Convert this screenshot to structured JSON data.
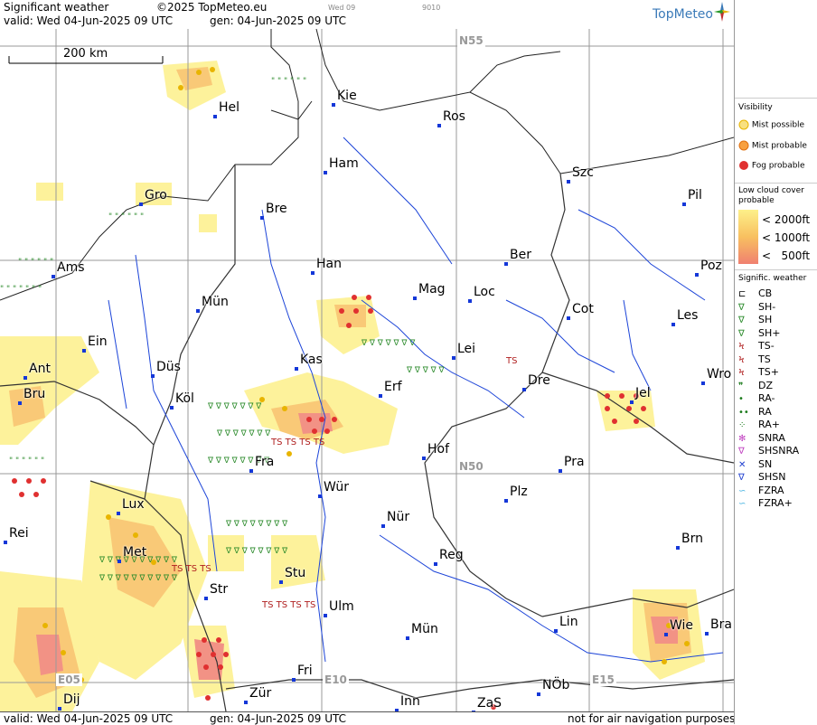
{
  "header": {
    "title": "Significant weather",
    "copyright": "©2025 TopMeteo.eu",
    "valid": "valid:  Wed  04-Jun-2025  09 UTC",
    "gen": "gen: 04-Jun-2025 09 UTC",
    "mini_day": "Wed 09",
    "mini_code": "9010",
    "logo": "TopMeteo"
  },
  "footer": {
    "valid": "valid:  Wed  04-Jun-2025  09 UTC",
    "gen": "gen: 04-Jun-2025 09 UTC",
    "note": "not for air navigation purposes"
  },
  "map": {
    "scale_label": "200 km",
    "grid_labels": [
      "N55",
      "N50",
      "E05",
      "E10",
      "E15"
    ],
    "cities": [
      "Hel",
      "Kie",
      "Ros",
      "Ham",
      "Szc",
      "Gro",
      "Bre",
      "Pil",
      "Ber",
      "Ams",
      "Han",
      "Poz",
      "Mag",
      "Loc",
      "Mün",
      "Cot",
      "Les",
      "Ein",
      "Kas",
      "Lei",
      "Ant",
      "Düs",
      "Dre",
      "Wro",
      "Erf",
      "Köl",
      "Jel",
      "Bru",
      "Hof",
      "Fra",
      "Pra",
      "Lux",
      "Wür",
      "Plz",
      "Rei",
      "Nür",
      "Met",
      "Brn",
      "Reg",
      "Stu",
      "Str",
      "Ulm",
      "Lin",
      "Wie",
      "Bra",
      "Mün",
      "Fri",
      "Inn",
      "ZaS",
      "NÖb",
      "Zür",
      "Dij"
    ]
  },
  "legend": {
    "visibility_title": "Visibility",
    "visibility": [
      "Mist possible",
      "Mist probable",
      "Fog probable"
    ],
    "lowcloud_title": "Low cloud cover probable",
    "lowcloud": [
      "< 2000ft",
      "< 1000ft",
      "<   500ft"
    ],
    "sigwx_title": "Signific. weather",
    "sigwx": [
      "CB",
      "SH-",
      "SH",
      "SH+",
      "TS-",
      "TS",
      "TS+",
      "DZ",
      "RA-",
      "RA",
      "RA+",
      "SNRA",
      "SHSNRA",
      "SN",
      "SHSN",
      "FZRA",
      "FZRA+"
    ],
    "colors": {
      "lowcloud_2000": "#fdf08a",
      "lowcloud_1000": "#f8c060",
      "lowcloud_500": "#f08070",
      "fog": "#e03030",
      "rain": "#1a7a1a",
      "shower": "#2a8a2a",
      "thunder": "#b02020",
      "river": "#1c44d8"
    }
  }
}
